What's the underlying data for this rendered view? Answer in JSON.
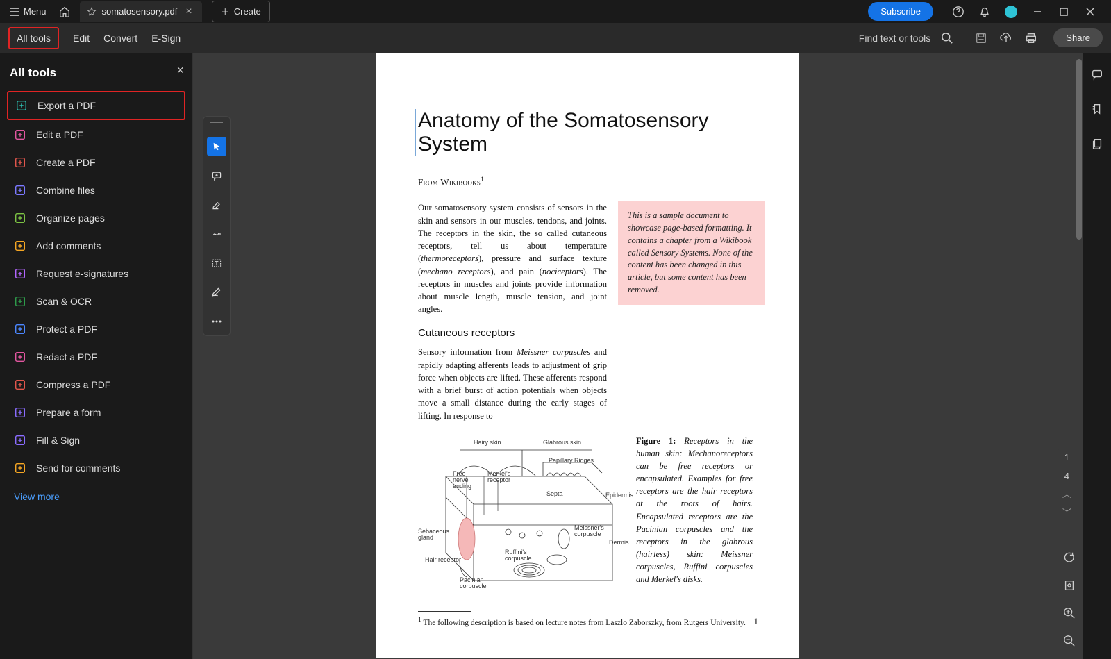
{
  "titlebar": {
    "menu": "Menu",
    "filename": "somatosensory.pdf",
    "create": "Create",
    "subscribe": "Subscribe"
  },
  "toolbar": {
    "all_tools": "All tools",
    "edit": "Edit",
    "convert": "Convert",
    "esign": "E-Sign",
    "find": "Find text or tools",
    "share": "Share"
  },
  "sidebar": {
    "title": "All tools",
    "tools": [
      {
        "label": "Export a PDF",
        "color": "#2ec4b6",
        "hl": true
      },
      {
        "label": "Edit a PDF",
        "color": "#e256a0"
      },
      {
        "label": "Create a PDF",
        "color": "#e2564c"
      },
      {
        "label": "Combine files",
        "color": "#7b78ff"
      },
      {
        "label": "Organize pages",
        "color": "#7cc243"
      },
      {
        "label": "Add comments",
        "color": "#f5a623"
      },
      {
        "label": "Request e-signatures",
        "color": "#b366ff"
      },
      {
        "label": "Scan & OCR",
        "color": "#2e9c4b"
      },
      {
        "label": "Protect a PDF",
        "color": "#4b86ff"
      },
      {
        "label": "Redact a PDF",
        "color": "#e256a0"
      },
      {
        "label": "Compress a PDF",
        "color": "#e2564c"
      },
      {
        "label": "Prepare a form",
        "color": "#8a6cff"
      },
      {
        "label": "Fill & Sign",
        "color": "#8a6cff"
      },
      {
        "label": "Send for comments",
        "color": "#f5a623"
      }
    ],
    "viewmore": "View more"
  },
  "document": {
    "title": "Anatomy of the Somatosensory System",
    "subtitle": "From Wikibooks",
    "subtitle_sup": "1",
    "para1_a": "Our somatosensory system consists of sensors in the skin and sensors in our muscles, tendons, and joints. The receptors in the skin, the so called cutaneous receptors, tell us about temperature (",
    "para1_b": "thermoreceptors",
    "para1_c": "), pressure and surface texture (",
    "para1_d": "mechano receptors",
    "para1_e": "), and pain (",
    "para1_f": "nociceptors",
    "para1_g": "). The receptors in muscles and joints provide information about muscle length, muscle tension, and joint angles.",
    "sidebox": "This is a sample document to showcase page-based formatting. It contains a chapter from a Wikibook called Sensory Systems. None of the content has been changed in this article, but some content has been removed.",
    "h3": "Cutaneous receptors",
    "para2_a": "Sensory information from ",
    "para2_b": "Meissner corpuscles",
    "para2_c": " and rapidly adapting afferents leads to adjustment of grip force when objects are lifted. These afferents respond with a brief burst of action potentials when objects move a small distance during the early stages of lifting. In response to",
    "figcap_lead": "Figure 1:",
    "figcap": "  Receptors in the human skin: Mechanoreceptors can be free receptors or encapsulated. Examples for free receptors are the hair receptors at the roots of hairs. Encapsulated receptors are the Pacinian corpuscles and the receptors in the glabrous (hairless) skin: Meissner corpuscles, Ruffini corpuscles and Merkel's disks.",
    "fig_labels": {
      "hairy": "Hairy skin",
      "glab": "Glabrous skin",
      "pap": "Papillary Ridges",
      "epi": "Epidermis",
      "dermis": "Dermis",
      "free": "Free nerve ending",
      "merk": "Merkel's receptor",
      "septa": "Septa",
      "meis": "Meissner's corpuscle",
      "seb": "Sebaceous gland",
      "hair": "Hair receptor",
      "pac": "Pacinian corpuscle",
      "ruf": "Ruffini's corpuscle"
    },
    "footnote_sup": "1",
    "footnote": " The following description is based on lecture notes from Laszlo Zaborszky, from Rutgers University.",
    "pagenum": "1"
  },
  "pagectl": {
    "current": "1",
    "total": "4"
  }
}
